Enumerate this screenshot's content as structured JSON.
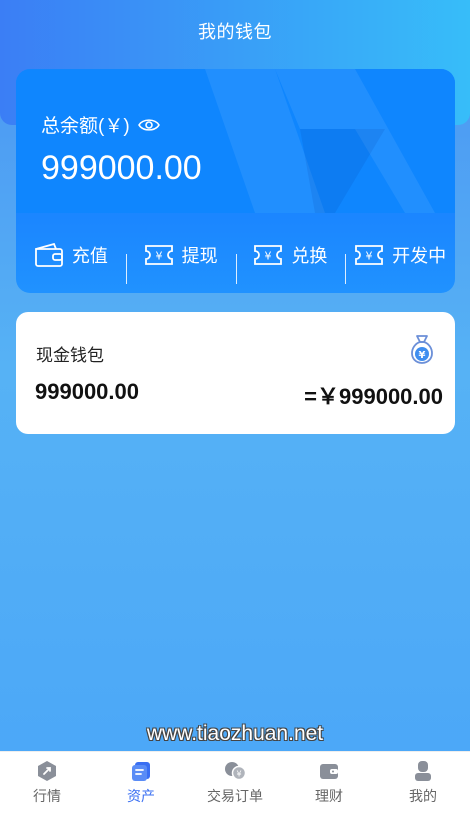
{
  "header": {
    "title": "我的钱包"
  },
  "balance": {
    "label": "总余额(￥)",
    "amount": "999000.00"
  },
  "actions": [
    {
      "label": "充值",
      "icon": "wallet-icon"
    },
    {
      "label": "提现",
      "icon": "ticket-icon"
    },
    {
      "label": "兑换",
      "icon": "ticket-icon"
    },
    {
      "label": "开发中",
      "icon": "ticket-icon"
    }
  ],
  "wallets": [
    {
      "name": "现金钱包",
      "amount": "999000.00",
      "converted": "=￥999000.00",
      "icon": "money-bag-icon"
    }
  ],
  "watermark": "www.tiaozhuan.net",
  "tabs": [
    {
      "label": "行情",
      "icon": "market-icon",
      "active": false
    },
    {
      "label": "资产",
      "icon": "assets-icon",
      "active": true
    },
    {
      "label": "交易订单",
      "icon": "orders-icon",
      "active": false
    },
    {
      "label": "理财",
      "icon": "wallet-icon",
      "active": false
    },
    {
      "label": "我的",
      "icon": "user-icon",
      "active": false
    }
  ],
  "colors": {
    "accent": "#3a6ff2",
    "card": "#1a84ff",
    "header_start": "#3b7ef5",
    "header_end": "#37bdf9"
  }
}
